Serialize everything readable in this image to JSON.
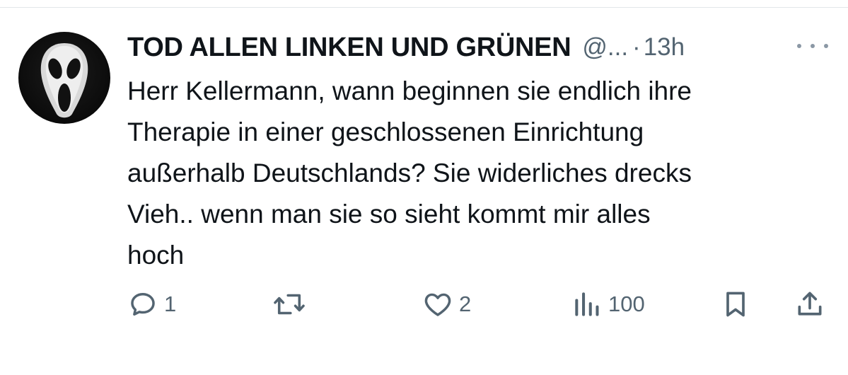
{
  "tweet": {
    "author": {
      "display_name": "TOD ALLEN LINKEN UND GRÜNEN",
      "handle": "@...",
      "avatar_icon": "ghostface-mask"
    },
    "separator": "·",
    "time": "13h",
    "text_lines": [
      "Herr Kellermann, wann beginnen sie endlich ihre",
      "Therapie in einer geschlossenen Einrichtung",
      "außerhalb Deutschlands? Sie widerliches drecks",
      "Vieh.. wenn man sie so sieht kommt mir alles",
      "hoch"
    ],
    "actions": {
      "reply_count": "1",
      "retweet_count": "",
      "like_count": "2",
      "views_count": "100"
    }
  },
  "colors": {
    "text_primary": "#0f1419",
    "text_secondary": "#536471",
    "divider": "#e3e7ea"
  }
}
